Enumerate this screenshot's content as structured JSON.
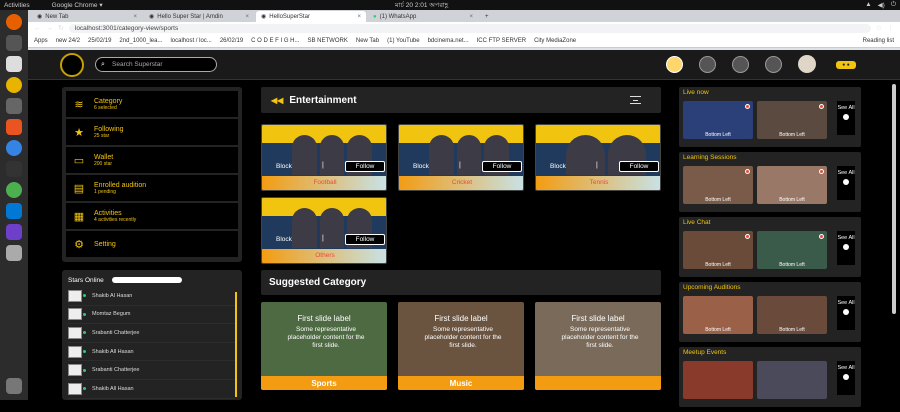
{
  "os": {
    "activities": "Activities",
    "app": "Google Chrome ▾",
    "clock": "মার্চ 20  2:01 অপরাহ্ণ"
  },
  "browser": {
    "tabs": [
      {
        "label": "New Tab"
      },
      {
        "label": "Hello Super Star | Amdin"
      },
      {
        "label": "HelloSuperStar"
      },
      {
        "label": "(1) WhatsApp"
      }
    ],
    "url": "localhost:3001/category-view/sports",
    "bookmarks": [
      "Apps",
      "new 24/2",
      "25/02/19",
      "2nd_1000_lea...",
      "localhost / loc...",
      "26/02/19",
      "C O D E F I G H...",
      "SB NETWORK",
      "New Tab",
      "(1) YouTube",
      "bdcinema.net...",
      "ICC FTP SERVER",
      "City MediaZone",
      "Reading list"
    ]
  },
  "header": {
    "search_placeholder": "Search Superstar",
    "pill": "● ●"
  },
  "left_menu": [
    {
      "icon": "layers-icon",
      "title": "Category",
      "sub": "6 selected"
    },
    {
      "icon": "star-icon",
      "title": "Following",
      "sub": "25 star"
    },
    {
      "icon": "wallet-icon",
      "title": "Wallet",
      "sub": "200 star"
    },
    {
      "icon": "id-card-icon",
      "title": "Enrolled audition",
      "sub": "1 pending"
    },
    {
      "icon": "clipboard-icon",
      "title": "Activities",
      "sub": "4 activities recently"
    },
    {
      "icon": "gear-icon",
      "title": "Setting",
      "sub": ""
    }
  ],
  "stars_online": {
    "title": "Stars Online",
    "list": [
      "Shakib Al Hasan",
      "Momtaz Begum",
      "Srabanti Chatterjee",
      "Shakib All Hasan",
      "Srabanti Chatterjee",
      "Shakib All Hasan"
    ]
  },
  "main": {
    "section_title": "Entertainment",
    "cards": [
      {
        "label": "Football",
        "block": "Block",
        "follow": "Follow",
        "banner": "#1f3a5c"
      },
      {
        "label": "Cricket",
        "block": "Block",
        "follow": "Follow",
        "banner": "#1a3d6b"
      },
      {
        "label": "Tennis",
        "block": "Block",
        "follow": "Follow",
        "banner": "#23405a"
      },
      {
        "label": "Others",
        "block": "Block",
        "follow": "Follow",
        "banner": "#1f3a5c"
      }
    ],
    "suggested_title": "Suggested Category",
    "suggested": [
      {
        "caption": "First slide label",
        "text": "Some representative placeholder content for the first slide.",
        "footer": "Sports"
      },
      {
        "caption": "First slide label",
        "text": "Some representative placeholder content for the first slide.",
        "footer": "Music"
      },
      {
        "caption": "First slide label",
        "text": "Some representative placeholder content for the first slide.",
        "footer": ""
      }
    ]
  },
  "right": [
    {
      "title": "Live now",
      "thumbs": [
        "Bottom Left",
        "Bottom Left"
      ],
      "see": "See All"
    },
    {
      "title": "Learning Sessions",
      "thumbs": [
        "Bottom Left",
        "Bottom Left"
      ],
      "see": "See All"
    },
    {
      "title": "Live Chat",
      "thumbs": [
        "Bottom Left",
        "Bottom Left"
      ],
      "see": "See All"
    },
    {
      "title": "Upcoming Auditions",
      "thumbs": [
        "Bottom Left",
        "Bottom Left"
      ],
      "see": "See All"
    },
    {
      "title": "Meetup Events",
      "thumbs": [
        "",
        ""
      ],
      "see": "See All"
    }
  ]
}
